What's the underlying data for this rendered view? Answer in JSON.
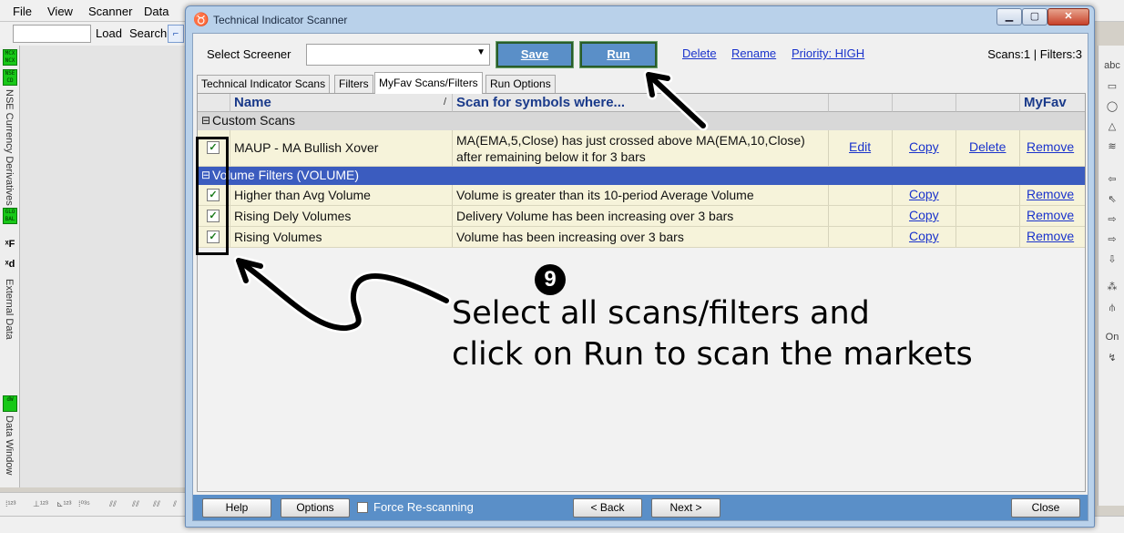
{
  "app": {
    "menu": [
      "File",
      "View",
      "Scanner",
      "Data"
    ],
    "menu_underline": [
      "F",
      "V",
      "S",
      "D"
    ],
    "toolbar": {
      "load": "Load",
      "search": "Search"
    },
    "left_panel": {
      "badge_mcx": "MCX NCX",
      "badge_nse": "NSE CD",
      "nse_label": "NSE Currency Derivatives",
      "badge_global": "GLO BAL",
      "external_label": "External Data",
      "badge_dw": "dW",
      "data_window_label": "Data Window"
    },
    "right_panel": {
      "abc": "abc",
      "on": "On"
    }
  },
  "dialog": {
    "title": "Technical Indicator Scanner",
    "select_screener_label": "Select Screener",
    "select_screener_value": "",
    "buttons": {
      "save": "Save",
      "run": "Run"
    },
    "links": {
      "delete": "Delete",
      "rename": "Rename",
      "priority": "Priority: HIGH"
    },
    "scan_count": "Scans:1 | Filters:3",
    "tabs": [
      "Technical Indicator Scans",
      "Filters",
      "MyFav Scans/Filters",
      "Run Options"
    ],
    "active_tab": 2,
    "grid": {
      "headers": {
        "name": "Name",
        "sort": "/",
        "scan": "Scan for symbols where...",
        "myfav": "MyFav"
      },
      "groups": [
        {
          "label": "Custom Scans",
          "sign": "⊟",
          "color": "#d8d8d8"
        },
        {
          "label": "Volume Filters (VOLUME)",
          "sign": "⊟",
          "color": "#3b5cbf"
        }
      ],
      "rows": [
        {
          "checked": "✓",
          "name": "MAUP - MA Bullish Xover",
          "condition1": "MA(EMA,5,Close) has just crossed above MA(EMA,10,Close)",
          "condition2": "after remaining below it for 3 bars",
          "edit": "Edit",
          "copy": "Copy",
          "delete": "Delete",
          "remove": "Remove"
        },
        {
          "checked": "✓",
          "name": "Higher than Avg Volume",
          "condition1": "Volume is greater than its 10-period Average Volume",
          "copy": "Copy",
          "remove": "Remove"
        },
        {
          "checked": "✓",
          "name": "Rising Dely Volumes",
          "condition1": "Delivery Volume has been increasing over 3 bars",
          "copy": "Copy",
          "remove": "Remove"
        },
        {
          "checked": "✓",
          "name": "Rising Volumes",
          "condition1": "Volume has been increasing over 3 bars",
          "copy": "Copy",
          "remove": "Remove"
        }
      ]
    },
    "bottom": {
      "help": "Help",
      "options": "Options",
      "force_rescan": "Force Re-scanning",
      "back": "< Back",
      "next": "Next >",
      "close": "Close"
    }
  },
  "annotation": {
    "step": "9",
    "line1": "Select all scans/filters and",
    "line2": "click on Run to scan the markets"
  },
  "colors": {
    "accent_blue": "#5a8fc8",
    "row_yellow": "#f6f3da",
    "group_blue": "#3b5cbf"
  }
}
